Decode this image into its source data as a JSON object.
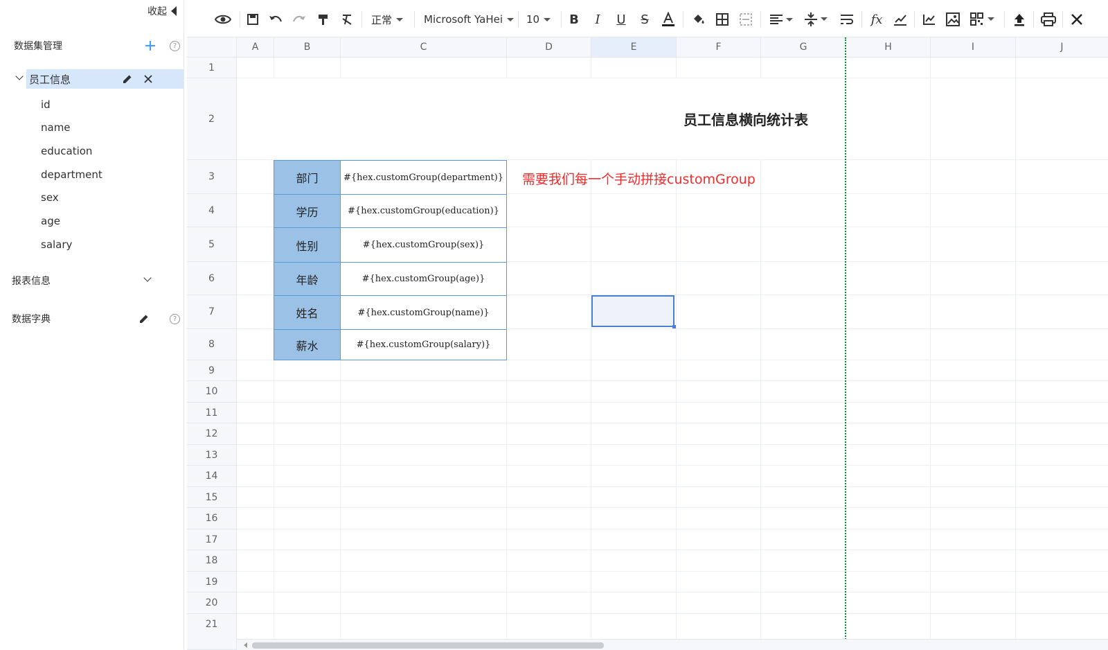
{
  "sidebar": {
    "collapse_label": "收起",
    "dataset_section": {
      "title": "数据集管理"
    },
    "dataset": {
      "name": "员工信息"
    },
    "fields": [
      "id",
      "name",
      "education",
      "department",
      "sex",
      "age",
      "salary"
    ],
    "report_section": {
      "title": "报表信息"
    },
    "dict_section": {
      "title": "数据字典"
    }
  },
  "toolbar": {
    "style_select": "正常",
    "font_select": "Microsoft YaHei",
    "size_select": "10",
    "icons": [
      "preview-icon",
      "save-icon",
      "undo-icon",
      "redo-icon",
      "format-painter-icon",
      "clear-format-icon",
      "bold-icon",
      "italic-icon",
      "underline-icon",
      "strikethrough-icon",
      "font-color-icon",
      "fill-color-icon",
      "border-icon",
      "merge-cells-icon",
      "align-icon",
      "vertical-align-icon",
      "wrap-text-icon",
      "function-icon",
      "chart-check-icon",
      "line-chart-icon",
      "image-icon",
      "qrcode-icon",
      "upload-icon",
      "print-icon",
      "close-icon"
    ]
  },
  "grid": {
    "columns": [
      "A",
      "B",
      "C",
      "D",
      "E",
      "F",
      "G",
      "H",
      "I",
      "J"
    ],
    "rows": [
      "1",
      "2",
      "3",
      "4",
      "5",
      "6",
      "7",
      "8",
      "9",
      "10",
      "11",
      "12",
      "13",
      "14",
      "15",
      "16",
      "17",
      "18",
      "19",
      "20",
      "21"
    ],
    "title": "员工信息横向统计表",
    "note": "需要我们每一个手动拼接customGroup",
    "labels": [
      "部门",
      "学历",
      "性别",
      "年龄",
      "姓名",
      "薪水"
    ],
    "expressions": [
      "#{hex.customGroup(department)}",
      "#{hex.customGroup(education)}",
      "#{hex.customGroup(sex)}",
      "#{hex.customGroup(age)}",
      "#{hex.customGroup(name)}",
      "#{hex.customGroup(salary)}"
    ],
    "selected_column": "E",
    "colors": {
      "label_fill": "#9bc2e6",
      "table_border": "#5b9bd5",
      "note_text": "#f52a2a",
      "page_break": "#0a8a2c",
      "selection": "#4a7fd6"
    }
  }
}
